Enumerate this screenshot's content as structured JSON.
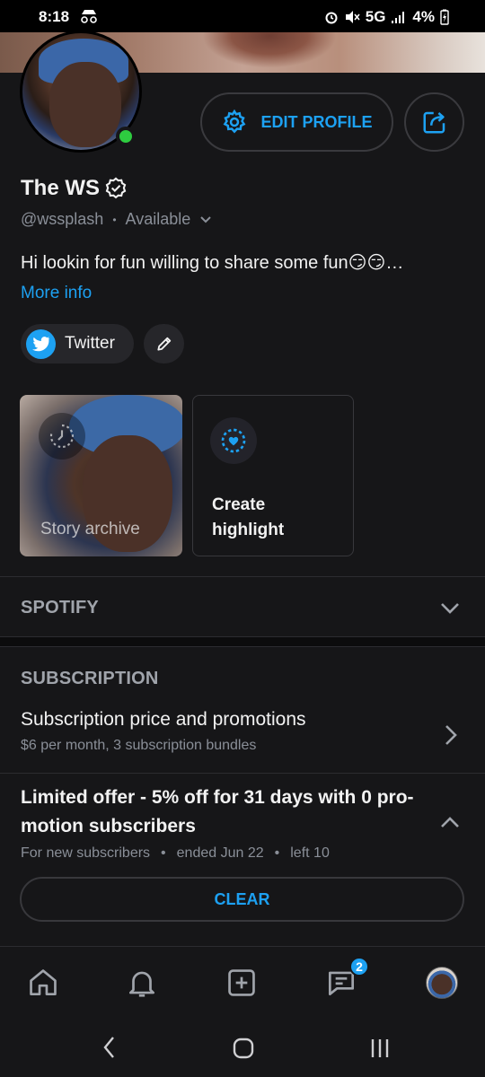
{
  "status_bar": {
    "time": "8:18",
    "network": "5G",
    "battery": "4%"
  },
  "profile": {
    "display_name": "The WS",
    "username": "@wssplash",
    "availability": "Available",
    "bio": "Hi lookin for fun willing to share some fun😏😏…",
    "more_info": "More info",
    "online": true
  },
  "header_buttons": {
    "edit_profile": "EDIT PROFILE"
  },
  "social": {
    "twitter_label": "Twitter"
  },
  "highlights": {
    "story_archive": "Story archive",
    "create_highlight": "Create highlight"
  },
  "sections": {
    "spotify": "SPOTIFY",
    "subscription": "SUBSCRIPTION"
  },
  "subscription": {
    "title": "Subscription price and promotions",
    "description": "$6 per month, 3 subscription bundles"
  },
  "offer": {
    "title": "Limited offer - 5% off for 31 days with 0 pro-motion subscribers",
    "audience": "For new subscribers",
    "ended": "ended Jun 22",
    "left": "left 10",
    "clear_label": "CLEAR"
  },
  "bottom_nav": {
    "messages_badge": "2"
  },
  "colors": {
    "accent": "#1da1f2",
    "online": "#2ecc40",
    "background": "#161618"
  }
}
